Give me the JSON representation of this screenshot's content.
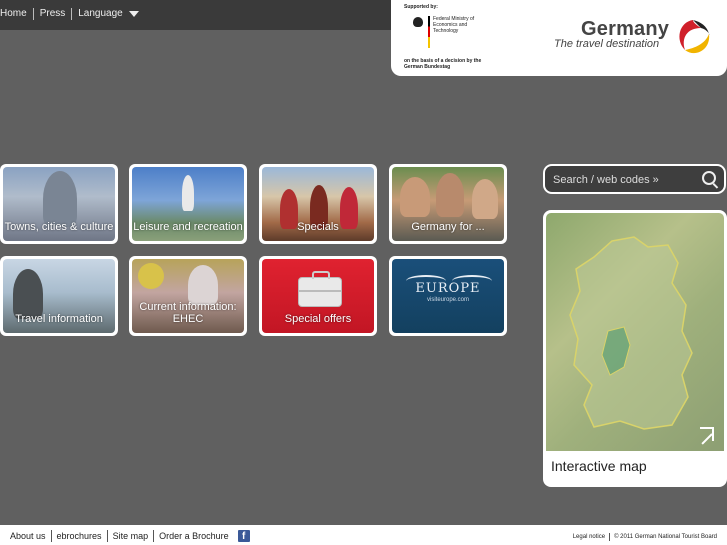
{
  "topnav": {
    "home": "Home",
    "press": "Press",
    "language": "Language"
  },
  "logo": {
    "supported_by": "Supported by:",
    "ministry": "Federal Ministry of Economics and Technology",
    "decision": "on the basis of a decision by the German Bundestag",
    "brand": "Germany",
    "tagline": "The travel destination"
  },
  "tiles": [
    {
      "label": "Towns, cities & culture"
    },
    {
      "label": "Leisure and recreation"
    },
    {
      "label": "Specials"
    },
    {
      "label": "Germany for ..."
    },
    {
      "label": "Travel information"
    },
    {
      "label": "Current information: EHEC"
    },
    {
      "label": "Special offers"
    },
    {
      "label": "EUROPE",
      "sub": "visiteurope.com"
    }
  ],
  "search": {
    "label": "Search / web codes »"
  },
  "map": {
    "label": "Interactive map"
  },
  "footer": {
    "links": [
      "About us",
      "ebrochures",
      "Site map",
      "Order a Brochure"
    ],
    "facebook": "f",
    "legal": "Legal notice",
    "copyright": "© 2011 German National Tourist Board"
  },
  "colors": {
    "background": "#606060",
    "topbar": "#3a3a3a",
    "special_offers_red": "#e02230",
    "europe_blue": "#1a4f7a"
  }
}
